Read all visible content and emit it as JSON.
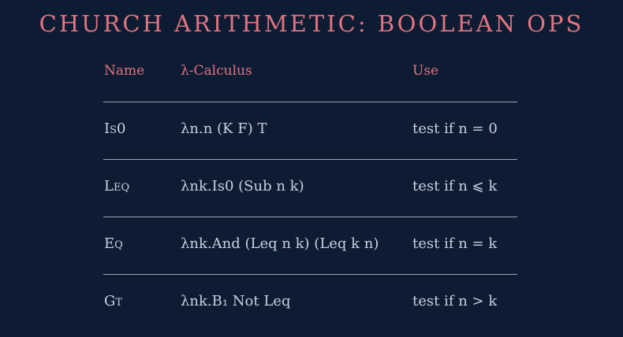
{
  "title": "CHURCH ARITHMETIC: BOOLEAN OPS",
  "headers": {
    "name": "Name",
    "lambda": "λ-Calculus",
    "use": "Use"
  },
  "rows": [
    {
      "name": "Is0",
      "lambda": "λn.n (K F) T",
      "use": "test if n = 0"
    },
    {
      "name": "Leq",
      "lambda": "λnk.Is0 (Sub n k)",
      "use": "test if n ⩽ k"
    },
    {
      "name": "Eq",
      "lambda": "λnk.And (Leq n k) (Leq k n)",
      "use": "test if n = k"
    },
    {
      "name": "Gt",
      "lambda": "λnk.B₁ Not Leq",
      "use": "test if n > k"
    }
  ],
  "colors": {
    "background": "#0e1c33",
    "accent": "#e07480",
    "text": "#c7d0e0",
    "rule": "#9aa6b8"
  }
}
